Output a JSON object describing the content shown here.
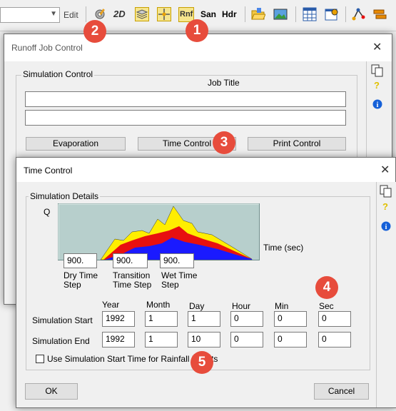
{
  "toolbar": {
    "edit_label": "Edit",
    "san_label": "San",
    "hdr_label": "Hdr",
    "rnf_label": "Rnf",
    "icon_2d_label": "2D"
  },
  "runoff_window": {
    "title": "Runoff Job Control",
    "group_label": "Simulation Control",
    "job_title_label": "Job Title",
    "job_title_line1": "",
    "job_title_line2": "",
    "evaporation_label": "Evaporation",
    "time_control_label": "Time Control",
    "print_control_label": "Print Control"
  },
  "time_window": {
    "title": "Time Control",
    "group_label": "Simulation Details",
    "q_label": "Q",
    "time_axis_label": "Time (sec)",
    "dry_time_step_value": "900.",
    "transition_time_step_value": "900.",
    "wet_time_step_value": "900.",
    "dry_time_step_label": "Dry Time\nStep",
    "transition_time_step_label": "Transition\nTime Step",
    "wet_time_step_label": "Wet Time\nStep",
    "columns": [
      "Year",
      "Month",
      "Day",
      "Hour",
      "Min",
      "Sec"
    ],
    "start_label": "Simulation Start",
    "end_label": "Simulation End",
    "start_values": [
      "1992",
      "1",
      "1",
      "0",
      "0",
      "0"
    ],
    "end_values": [
      "1992",
      "1",
      "10",
      "0",
      "0",
      "0"
    ],
    "rainfall_checkbox_label": "Use Simulation Start Time for Rainfall Events",
    "rainfall_checkbox_checked": false,
    "ok_label": "OK",
    "cancel_label": "Cancel"
  },
  "badges": [
    "1",
    "2",
    "3",
    "4",
    "5"
  ],
  "colors": {
    "badge": "#e74c3c",
    "graph_bg": "#b7cfcc",
    "graph_yellow": "#ffee00",
    "graph_red": "#e81010",
    "graph_blue": "#1a1aff",
    "help_icon": "#e0c000",
    "info_icon": "#1560d8"
  }
}
